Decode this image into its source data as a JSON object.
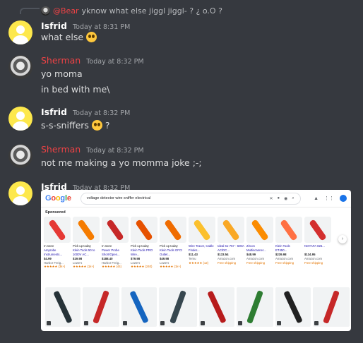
{
  "reply": {
    "username": "@Bear",
    "text": "yknow what else jiggl jiggl- ? ¿ o.O ?"
  },
  "messages": [
    {
      "username": "Isfrid",
      "timestamp": "Today at 8:31 PM",
      "lines": [
        "what else"
      ],
      "emoji": "pleading-face-emoji"
    },
    {
      "username": "Sherman",
      "timestamp": "Today at 8:32 PM",
      "lines": [
        "yo moma",
        "in bed with me\\"
      ]
    },
    {
      "username": "Isfrid",
      "timestamp": "Today at 8:32 PM",
      "lines": [
        "s-s-sniffers",
        "?"
      ],
      "emoji": "pleading-face-emoji"
    },
    {
      "username": "Sherman",
      "timestamp": "Today at 8:32 PM",
      "lines": [
        "not me making a yo momma joke ;-;"
      ]
    },
    {
      "username": "Isfrid",
      "timestamp": "Today at 8:32 PM",
      "attachment": "google-shopping-screenshot"
    }
  ],
  "colors": {
    "background": "#36393f",
    "sherman_name": "#ed4245",
    "isfrid_avatar": "#fde84c",
    "text": "#dcddde",
    "timestamp": "#a3a6aa"
  },
  "google": {
    "logo": [
      "G",
      "o",
      "o",
      "g",
      "l",
      "e"
    ],
    "query": "voltage detector wire sniffer electrical",
    "sponsored": "Sponsored",
    "icons": [
      "close-icon",
      "mic-icon",
      "lens-icon",
      "search-icon",
      "labs-icon",
      "apps-icon",
      "account-avatar"
    ],
    "products": [
      {
        "title": "Amprobe Instruments...",
        "price": "$4.99",
        "store": "Harbor Freig...",
        "rating": "★★★★★ (3k+)",
        "badge": "In store",
        "color": "#e53935"
      },
      {
        "title": "Klein Tools 50 to 1000V AC...",
        "price": "$19.98",
        "store": "Lowe's",
        "rating": "★★★★★ (1k+)",
        "badge": "Pick up today",
        "color": "#f57c00"
      },
      {
        "title": "Power Probe Short/Open...",
        "price": "$188.40",
        "store": "Harbor Freig...",
        "rating": "★★★★★ (44)",
        "badge": "In store",
        "color": "#c62828"
      },
      {
        "title": "Klein Tools PRO Wire...",
        "price": "$79.98",
        "store": "Lowe's",
        "rating": "★★★★★ (240)",
        "badge": "Pick up today",
        "color": "#e65100"
      },
      {
        "title": "Klein Tools GFCI Outlet...",
        "price": "$49.98",
        "store": "Lowe's",
        "rating": "★★★★★ (1k+)",
        "badge": "Pick up today",
        "color": "#ef6c00"
      },
      {
        "title": "Wire Tracer, Cable Finder...",
        "price": "$11.43",
        "store": "Temu",
        "rating": "★★★★★ (12)",
        "badge": "",
        "color": "#fbc02d"
      },
      {
        "title": "Ideal 61-757 - 600A AC/DC...",
        "price": "$133.54",
        "store": "Amazon.com",
        "rating": "Free shipping",
        "badge": "",
        "color": "#f9a825"
      },
      {
        "title": "Zircon Multiscanner...",
        "price": "$48.99",
        "store": "Amazon.com",
        "rating": "Free shipping",
        "badge": "",
        "color": "#fb8c00"
      },
      {
        "title": "Klein Tools ET450...",
        "price": "$239.98",
        "store": "Amazon.com",
        "rating": "Free shipping",
        "badge": "",
        "color": "#ff7043"
      },
      {
        "title": "NOYAFA 826...",
        "price": "$134.95",
        "store": "Amazon.com",
        "rating": "Free shipping",
        "badge": "",
        "color": "#d32f2f"
      }
    ],
    "image_results": [
      {
        "color": "#263238"
      },
      {
        "color": "#c62828"
      },
      {
        "color": "#1565c0"
      },
      {
        "color": "#37474f"
      },
      {
        "color": "#b71c1c"
      },
      {
        "color": "#2e7d32"
      },
      {
        "color": "#212121"
      },
      {
        "color": "#c62828"
      }
    ]
  }
}
